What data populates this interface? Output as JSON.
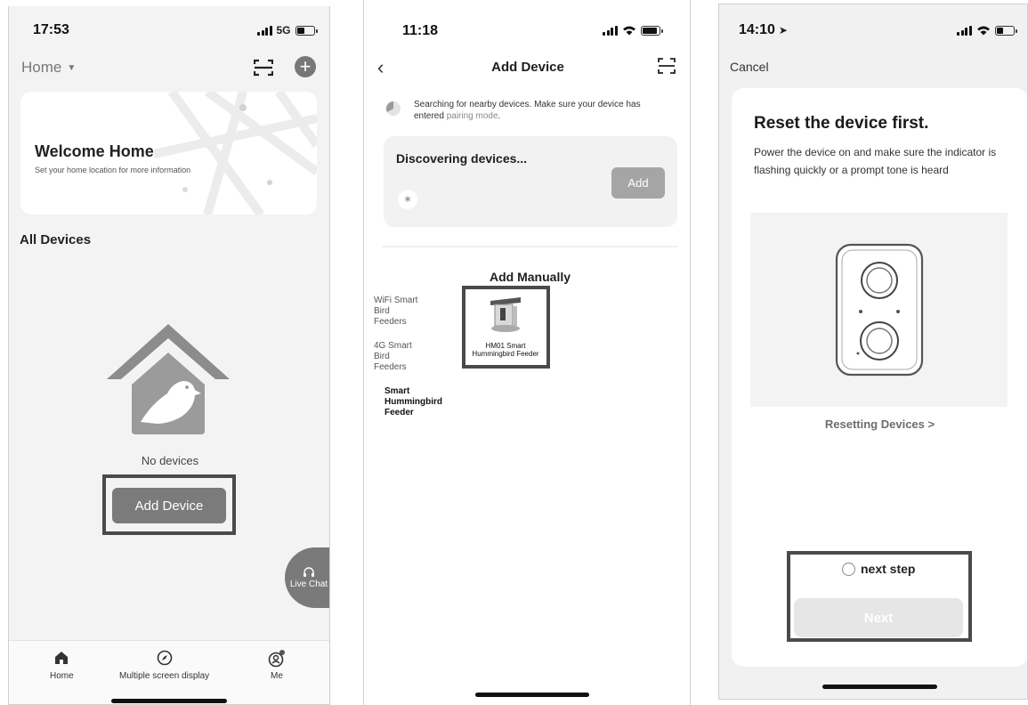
{
  "screen1": {
    "time": "17:53",
    "network": "5G",
    "home_selector": "Home",
    "welcome_title": "Welcome Home",
    "welcome_subtitle": "Set your home location for more information",
    "section_title": "All Devices",
    "empty_text": "No devices",
    "add_device_button": "Add Device",
    "live_chat": "Live Chat",
    "tabs": [
      {
        "label": "Home",
        "icon": "home-icon"
      },
      {
        "label": "Multiple screen display",
        "icon": "compass-icon"
      },
      {
        "label": "Me",
        "icon": "profile-icon"
      }
    ]
  },
  "screen2": {
    "time": "11:18",
    "title": "Add Device",
    "searching_text": "Searching for nearby devices. Make sure your device has entered",
    "pairing_link": "pairing mode",
    "searching_end": ".",
    "discovering": "Discovering devices...",
    "add_button": "Add",
    "add_manually": "Add Manually",
    "categories": [
      {
        "label": "WiFi Smart Bird Feeders",
        "selected": false
      },
      {
        "label": "4G Smart Bird Feeders",
        "selected": false
      },
      {
        "label": "Smart Hummingbird Feeder",
        "selected": true
      }
    ],
    "product_label": "HM01 Smart Hummingbird Feeder"
  },
  "screen3": {
    "time": "14:10",
    "cancel": "Cancel",
    "heading": "Reset the device first.",
    "instructions": "Power the device on and make sure the indicator is flashing quickly or a prompt tone is heard",
    "resetting_link": "Resetting Devices >",
    "next_step_label": "next step",
    "next_button": "Next"
  },
  "colors": {
    "button_gray": "#7b7b7b",
    "highlight_box": "#4a4a4a",
    "disabled_button": "#e6e6e6"
  }
}
